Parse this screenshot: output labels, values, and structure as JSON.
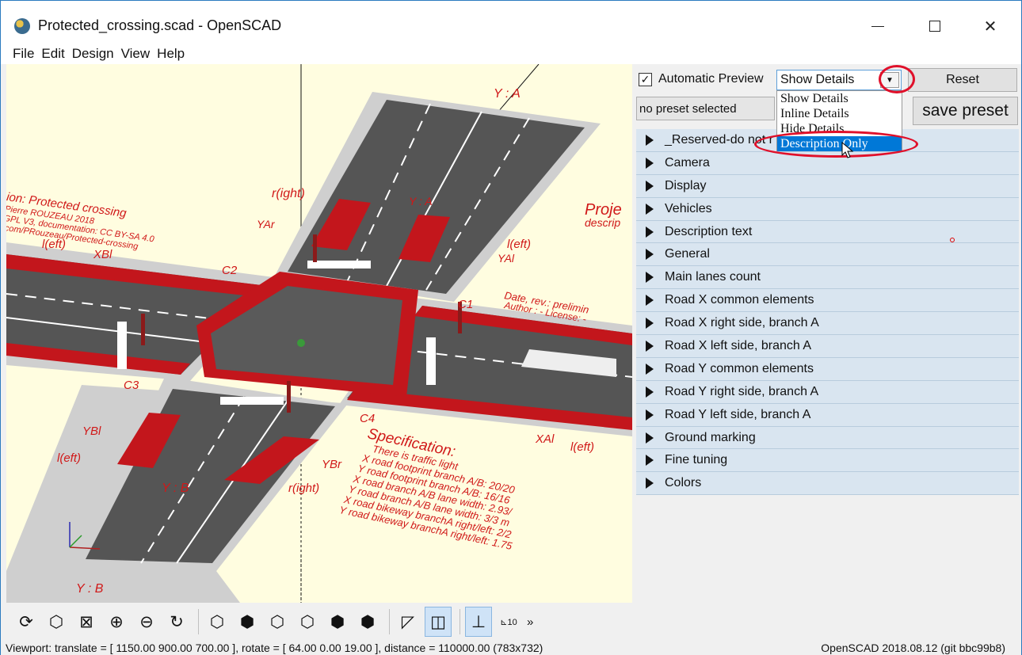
{
  "window": {
    "title": "Protected_crossing.scad - OpenSCAD"
  },
  "menu": [
    "File",
    "Edit",
    "Design",
    "View",
    "Help"
  ],
  "customizer": {
    "automatic_preview_label": "Automatic Preview",
    "automatic_preview_checked": true,
    "detail_mode": "Show Details",
    "detail_options": [
      "Show Details",
      "Inline Details",
      "Hide Details",
      "Description Only"
    ],
    "highlighted_option": "Description Only",
    "reset_label": "Reset",
    "preset_value": "no preset selected",
    "save_preset_label": "save preset",
    "sections": [
      "_Reserved-do not r",
      "Camera",
      "Display",
      "Vehicles",
      "Description text",
      "General",
      "Main lanes count",
      "Road X common elements",
      "Road X right side, branch A",
      "Road X left side, branch A",
      "Road Y common elements",
      "Road Y right side, branch A",
      "Road Y left side, branch A",
      "Ground marking",
      "Fine tuning",
      "Colors"
    ]
  },
  "viewport_labels": {
    "ya_top": "Y : A",
    "right_top": "r(ight)",
    "yar": "YAr",
    "ya_mid": "Y : A",
    "left_top": "l(eft)",
    "yal": "YAl",
    "xbl": "XBl",
    "left_left": "l(eft)",
    "c1": "C1",
    "c2": "C2",
    "c3": "C3",
    "c4": "C4",
    "ybl": "YBl",
    "left_bottom": "l(eft)",
    "ybr": "YBr",
    "right_bottom": "r(ight)",
    "yb_mid": "Y : B",
    "yb_bottom": "Y : B",
    "xal": "XAl",
    "left_xa": "l(eft)",
    "proj": "Proje",
    "descrip": "descrip",
    "date_line": "Date, rev.: prelimin",
    "author_line": "Author : - License: -",
    "desc_lines": [
      "ion: Protected crossing",
      "Pierre ROUZEAU 2018",
      "GPL V3, documentation: CC BY-SA 4.0",
      ".com/PRouzeau/Protected-crossing"
    ],
    "spec_title": "Specification:",
    "spec_lines": [
      "There is traffic light",
      "X road footprint branch A/B: 20/20",
      "Y road footprint branch A/B: 16/16",
      "X road branch A/B lane width: 2.93/",
      "Y road branch A/B lane width: 3/3 m",
      "X road bikeway branchA right/left: 2/2",
      "Y road bikeway branchA right/left: 1.75"
    ]
  },
  "toolbar": {
    "buttons": [
      "preview-icon",
      "render-icon",
      "view-all-icon",
      "zoom-in-icon",
      "zoom-out-icon",
      "reset-view-icon",
      "view-right-icon",
      "view-top-icon",
      "view-bottom-icon",
      "view-left-icon",
      "view-front-icon",
      "view-back-icon",
      "perspective-icon",
      "orthogonal-icon",
      "show-axes-icon",
      "show-scale-icon"
    ],
    "more": "»",
    "scale_digit": "10"
  },
  "status": {
    "viewport": "Viewport: translate = [ 1150.00 900.00 700.00 ], rotate = [ 64.00 0.00 19.00 ], distance = 110000.00 (783x732)",
    "version": "OpenSCAD 2018.08.12 (git bbc99b8)"
  },
  "colors": {
    "viewport_bg": "#fffde0",
    "sidewalk": "#cfcfcf",
    "road": "#555555",
    "bikeway": "#c3161c",
    "annotation": "#e0102a",
    "selection": "#0078d7"
  }
}
